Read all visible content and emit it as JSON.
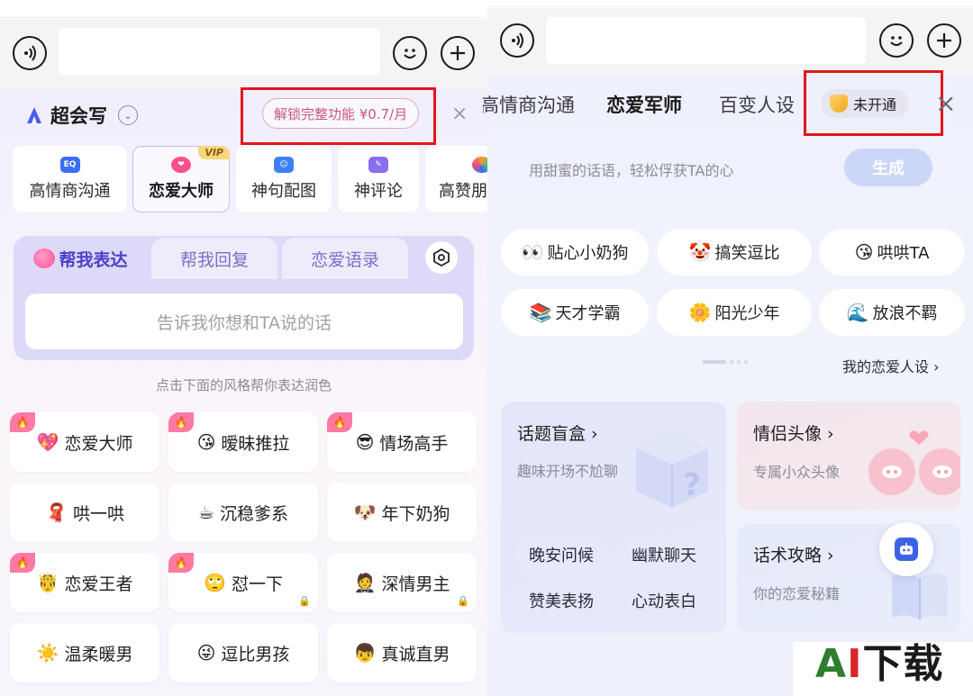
{
  "left": {
    "brand": {
      "name": "超会写"
    },
    "unlock_label": "解锁完整功能 ¥0.7/月",
    "close_icon": "×",
    "categories": [
      {
        "label": "高情商沟通",
        "icon": "EQ",
        "color": "#3b6ef5"
      },
      {
        "label": "恋爱大师",
        "icon": "❤",
        "color": "#ff4f89",
        "badge": "VIP"
      },
      {
        "label": "神句配图",
        "icon": "☺",
        "color": "#3d7ff5"
      },
      {
        "label": "神评论",
        "icon": "✎",
        "color": "#8a6cf0"
      },
      {
        "label": "高赞朋",
        "icon": "✿",
        "color": "#f59a2b"
      }
    ],
    "tabs": [
      {
        "label": "帮我表达"
      },
      {
        "label": "帮我回复"
      },
      {
        "label": "恋爱语录"
      }
    ],
    "input_placeholder": "告诉我你想和TA说的话",
    "hint": "点击下面的风格帮你表达润色",
    "styles": [
      {
        "emoji": "💖",
        "label": "恋爱大师"
      },
      {
        "emoji": "😘",
        "label": "暧昧推拉"
      },
      {
        "emoji": "😎",
        "label": "情场高手"
      },
      {
        "emoji": "🧣",
        "label": "哄一哄"
      },
      {
        "emoji": "☕",
        "label": "沉稳爹系"
      },
      {
        "emoji": "🐶",
        "label": "年下奶狗"
      },
      {
        "emoji": "🤴",
        "label": "恋爱王者"
      },
      {
        "emoji": "🙄",
        "label": "怼一下"
      },
      {
        "emoji": "🤵",
        "label": "深情男主"
      },
      {
        "emoji": "☀️",
        "label": "温柔暖男"
      },
      {
        "emoji": "😜",
        "label": "逗比男孩"
      },
      {
        "emoji": "👦",
        "label": "真诚直男"
      }
    ]
  },
  "right": {
    "tabs": [
      {
        "label": "高情商沟通"
      },
      {
        "label": "恋爱军师"
      },
      {
        "label": "百变人设"
      }
    ],
    "not_open_label": "未开通",
    "close_icon": "×",
    "placeholder": "用甜蜜的话语，轻松俘获TA的心",
    "generate_label": "生成",
    "personas": [
      {
        "emoji": "👀",
        "label": "贴心小奶狗"
      },
      {
        "emoji": "🤡",
        "label": "搞笑逗比"
      },
      {
        "emoji": "😘",
        "label": "哄哄TA"
      },
      {
        "emoji": "📚",
        "label": "天才学霸"
      },
      {
        "emoji": "🌼",
        "label": "阳光少年"
      },
      {
        "emoji": "🌊",
        "label": "放浪不羁"
      }
    ],
    "my_persona": "我的恋爱人设 ›",
    "cards": {
      "topic": {
        "title": "话题盲盒 ›",
        "sub": "趣味开场不尬聊",
        "chips": [
          "晚安问候",
          "幽默聊天",
          "赞美表扬",
          "心动表白"
        ]
      },
      "avatar": {
        "title": "情侣头像 ›",
        "sub": "专属小众头像"
      },
      "tactics": {
        "title": "话术攻略 ›",
        "sub": "你的恋爱秘籍"
      }
    }
  },
  "watermark": {
    "a": "A",
    "i": "I",
    "rest": "下载"
  }
}
